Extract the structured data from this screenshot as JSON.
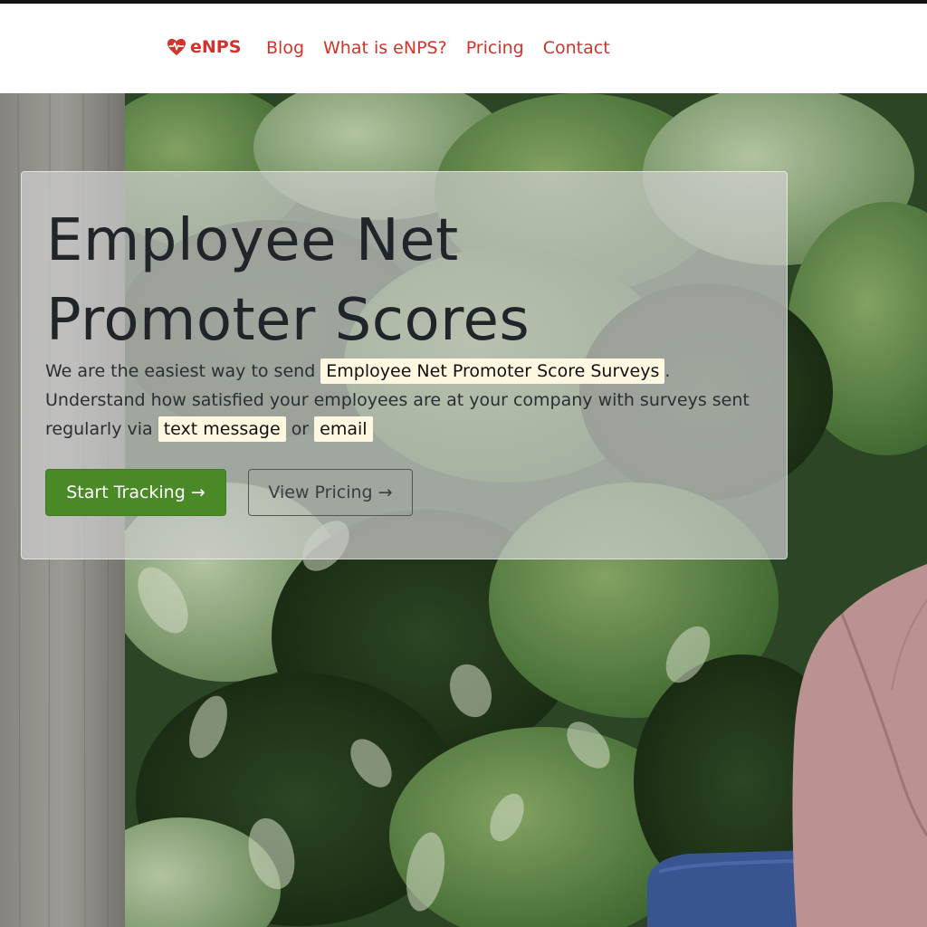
{
  "nav": {
    "brand": "eNPS",
    "brand_icon": "heart-pulse-icon",
    "brand_color": "#d0342c",
    "links": [
      "Blog",
      "What is eNPS?",
      "Pricing",
      "Contact"
    ]
  },
  "hero": {
    "title_line1": "Employee Net",
    "title_line2": "Promoter Scores",
    "lead_prefix": "We are the easiest way to send",
    "highlight_surveys": "Employee Net Promoter Score Surveys",
    "lead_period": ".",
    "lead_middle": "Understand how satisfied your employees are at your company with surveys sent regularly via",
    "highlight_text": "text message",
    "lead_or": "or",
    "highlight_email": "email",
    "primary_button": "Start Tracking →",
    "secondary_button": "View Pricing →",
    "primary_color": "#4a8a26",
    "highlight_color": "#fff8e1"
  }
}
